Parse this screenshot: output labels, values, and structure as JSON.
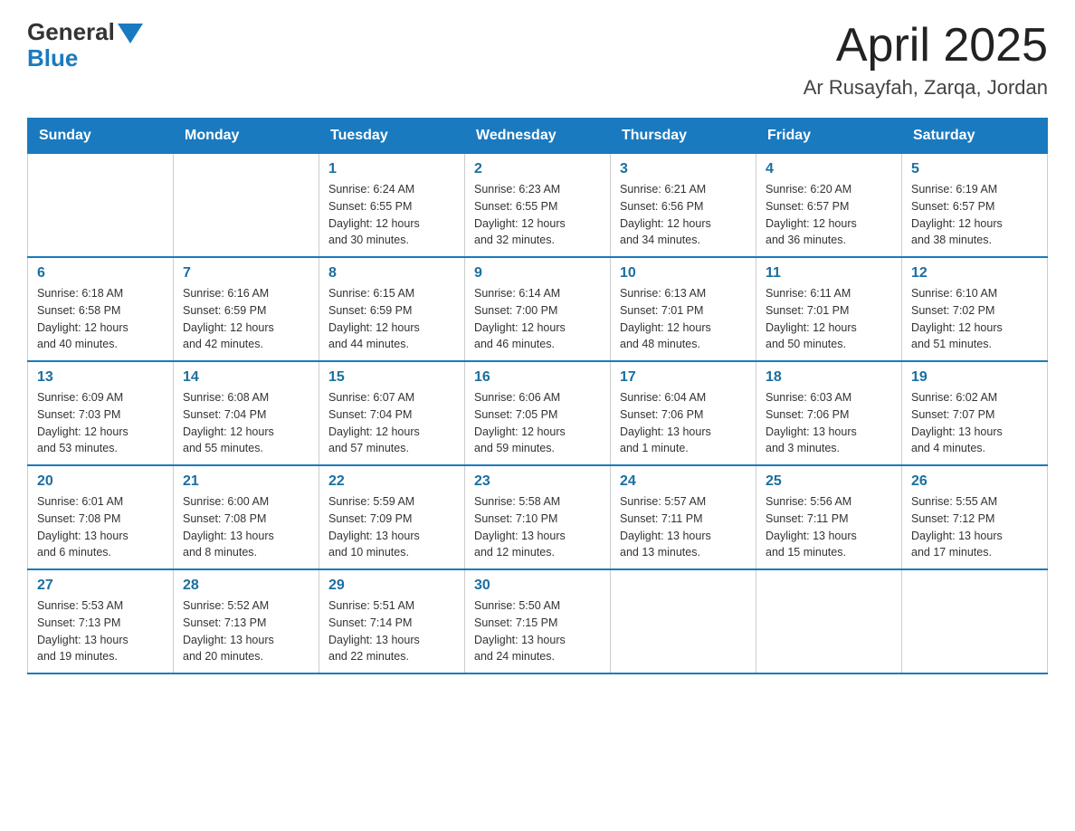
{
  "header": {
    "logo_general": "General",
    "logo_blue": "Blue",
    "title": "April 2025",
    "location": "Ar Rusayfah, Zarqa, Jordan"
  },
  "calendar": {
    "days_of_week": [
      "Sunday",
      "Monday",
      "Tuesday",
      "Wednesday",
      "Thursday",
      "Friday",
      "Saturday"
    ],
    "weeks": [
      [
        {
          "day": "",
          "info": ""
        },
        {
          "day": "",
          "info": ""
        },
        {
          "day": "1",
          "info": "Sunrise: 6:24 AM\nSunset: 6:55 PM\nDaylight: 12 hours\nand 30 minutes."
        },
        {
          "day": "2",
          "info": "Sunrise: 6:23 AM\nSunset: 6:55 PM\nDaylight: 12 hours\nand 32 minutes."
        },
        {
          "day": "3",
          "info": "Sunrise: 6:21 AM\nSunset: 6:56 PM\nDaylight: 12 hours\nand 34 minutes."
        },
        {
          "day": "4",
          "info": "Sunrise: 6:20 AM\nSunset: 6:57 PM\nDaylight: 12 hours\nand 36 minutes."
        },
        {
          "day": "5",
          "info": "Sunrise: 6:19 AM\nSunset: 6:57 PM\nDaylight: 12 hours\nand 38 minutes."
        }
      ],
      [
        {
          "day": "6",
          "info": "Sunrise: 6:18 AM\nSunset: 6:58 PM\nDaylight: 12 hours\nand 40 minutes."
        },
        {
          "day": "7",
          "info": "Sunrise: 6:16 AM\nSunset: 6:59 PM\nDaylight: 12 hours\nand 42 minutes."
        },
        {
          "day": "8",
          "info": "Sunrise: 6:15 AM\nSunset: 6:59 PM\nDaylight: 12 hours\nand 44 minutes."
        },
        {
          "day": "9",
          "info": "Sunrise: 6:14 AM\nSunset: 7:00 PM\nDaylight: 12 hours\nand 46 minutes."
        },
        {
          "day": "10",
          "info": "Sunrise: 6:13 AM\nSunset: 7:01 PM\nDaylight: 12 hours\nand 48 minutes."
        },
        {
          "day": "11",
          "info": "Sunrise: 6:11 AM\nSunset: 7:01 PM\nDaylight: 12 hours\nand 50 minutes."
        },
        {
          "day": "12",
          "info": "Sunrise: 6:10 AM\nSunset: 7:02 PM\nDaylight: 12 hours\nand 51 minutes."
        }
      ],
      [
        {
          "day": "13",
          "info": "Sunrise: 6:09 AM\nSunset: 7:03 PM\nDaylight: 12 hours\nand 53 minutes."
        },
        {
          "day": "14",
          "info": "Sunrise: 6:08 AM\nSunset: 7:04 PM\nDaylight: 12 hours\nand 55 minutes."
        },
        {
          "day": "15",
          "info": "Sunrise: 6:07 AM\nSunset: 7:04 PM\nDaylight: 12 hours\nand 57 minutes."
        },
        {
          "day": "16",
          "info": "Sunrise: 6:06 AM\nSunset: 7:05 PM\nDaylight: 12 hours\nand 59 minutes."
        },
        {
          "day": "17",
          "info": "Sunrise: 6:04 AM\nSunset: 7:06 PM\nDaylight: 13 hours\nand 1 minute."
        },
        {
          "day": "18",
          "info": "Sunrise: 6:03 AM\nSunset: 7:06 PM\nDaylight: 13 hours\nand 3 minutes."
        },
        {
          "day": "19",
          "info": "Sunrise: 6:02 AM\nSunset: 7:07 PM\nDaylight: 13 hours\nand 4 minutes."
        }
      ],
      [
        {
          "day": "20",
          "info": "Sunrise: 6:01 AM\nSunset: 7:08 PM\nDaylight: 13 hours\nand 6 minutes."
        },
        {
          "day": "21",
          "info": "Sunrise: 6:00 AM\nSunset: 7:08 PM\nDaylight: 13 hours\nand 8 minutes."
        },
        {
          "day": "22",
          "info": "Sunrise: 5:59 AM\nSunset: 7:09 PM\nDaylight: 13 hours\nand 10 minutes."
        },
        {
          "day": "23",
          "info": "Sunrise: 5:58 AM\nSunset: 7:10 PM\nDaylight: 13 hours\nand 12 minutes."
        },
        {
          "day": "24",
          "info": "Sunrise: 5:57 AM\nSunset: 7:11 PM\nDaylight: 13 hours\nand 13 minutes."
        },
        {
          "day": "25",
          "info": "Sunrise: 5:56 AM\nSunset: 7:11 PM\nDaylight: 13 hours\nand 15 minutes."
        },
        {
          "day": "26",
          "info": "Sunrise: 5:55 AM\nSunset: 7:12 PM\nDaylight: 13 hours\nand 17 minutes."
        }
      ],
      [
        {
          "day": "27",
          "info": "Sunrise: 5:53 AM\nSunset: 7:13 PM\nDaylight: 13 hours\nand 19 minutes."
        },
        {
          "day": "28",
          "info": "Sunrise: 5:52 AM\nSunset: 7:13 PM\nDaylight: 13 hours\nand 20 minutes."
        },
        {
          "day": "29",
          "info": "Sunrise: 5:51 AM\nSunset: 7:14 PM\nDaylight: 13 hours\nand 22 minutes."
        },
        {
          "day": "30",
          "info": "Sunrise: 5:50 AM\nSunset: 7:15 PM\nDaylight: 13 hours\nand 24 minutes."
        },
        {
          "day": "",
          "info": ""
        },
        {
          "day": "",
          "info": ""
        },
        {
          "day": "",
          "info": ""
        }
      ]
    ]
  }
}
